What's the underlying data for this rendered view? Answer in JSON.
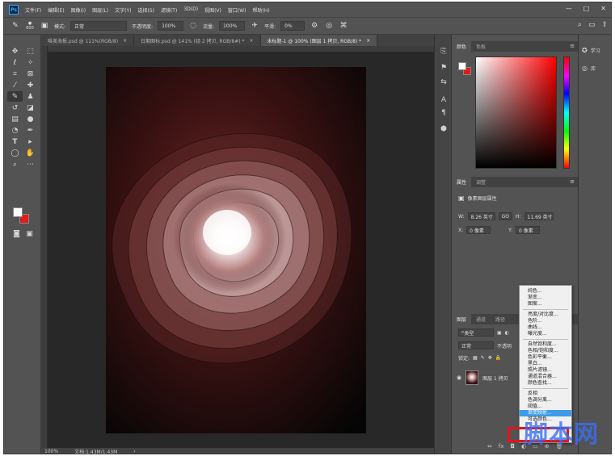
{
  "app": {
    "logo": "Ps",
    "menu": [
      "文件(F)",
      "编辑(E)",
      "图像(I)",
      "图层(L)",
      "文字(Y)",
      "选择(S)",
      "滤镜(T)",
      "3D(D)",
      "视图(V)",
      "窗口(W)",
      "帮助(H)"
    ],
    "window_controls": [
      "—",
      "□",
      "✕"
    ]
  },
  "options_bar": {
    "brush_size": "600",
    "mode_label": "模式:",
    "mode_value": "正常",
    "opacity_label": "不透明度:",
    "opacity_value": "100%",
    "flow_label": "流量:",
    "flow_value": "100%",
    "smoothing_label": "平滑:",
    "smoothing_value": "0%"
  },
  "doc_tabs": [
    {
      "label": "唯美海报.psd @ 111%(RGB/8)",
      "close": "×",
      "active": false
    },
    {
      "label": "日期图标.psd @ 141% (组 2 拷贝, RGB/8#) *",
      "close": "×",
      "active": false
    },
    {
      "label": "未标题-1 @ 100% (图层 1 拷贝, RGB/8) *",
      "close": "×",
      "active": true
    }
  ],
  "status": {
    "zoom": "100%",
    "doc_size": "文档:1.43M/1.43M",
    "arrow": "›"
  },
  "color_panel": {
    "tabs": [
      "颜色",
      "色板"
    ],
    "foreground": "#ffffff",
    "background": "#e21c1c"
  },
  "properties_panel": {
    "tabs": [
      "属性",
      "调整"
    ],
    "title": "像素图层属性",
    "w_label": "W:",
    "w_value": "8.26 英寸",
    "link": "GO",
    "h_label": "H:",
    "h_value": "11.69 英寸",
    "x_label": "X:",
    "x_value": "0 像素",
    "y_label": "Y:",
    "y_value": "0 像素"
  },
  "layers_panel": {
    "tabs": [
      "图层",
      "通道",
      "路径"
    ],
    "filter": "类型",
    "blend_mode": "正常",
    "opacity_label": "不透明",
    "lock_label": "锁定:",
    "layer_name": "图层 1 拷贝",
    "bottom_icons": [
      "⇔",
      "fx",
      "◘",
      "◐",
      "▭",
      "⊕",
      "🗑"
    ]
  },
  "adjustment_menu": {
    "group1": [
      "纯色...",
      "渐变...",
      "图案..."
    ],
    "group2": [
      "亮度/对比度...",
      "色阶...",
      "曲线...",
      "曝光度..."
    ],
    "group3": [
      "自然饱和度...",
      "色相/饱和度...",
      "色彩平衡...",
      "黑白...",
      "照片滤镜...",
      "通道混合器...",
      "颜色查找..."
    ],
    "group4": [
      "反相",
      "色调分离...",
      "阈值...",
      "渐变映射...",
      "可选颜色..."
    ],
    "highlighted": "渐变映射..."
  },
  "right_dock": {
    "learn": "学习",
    "libraries": "库"
  },
  "watermark": "脚本网"
}
